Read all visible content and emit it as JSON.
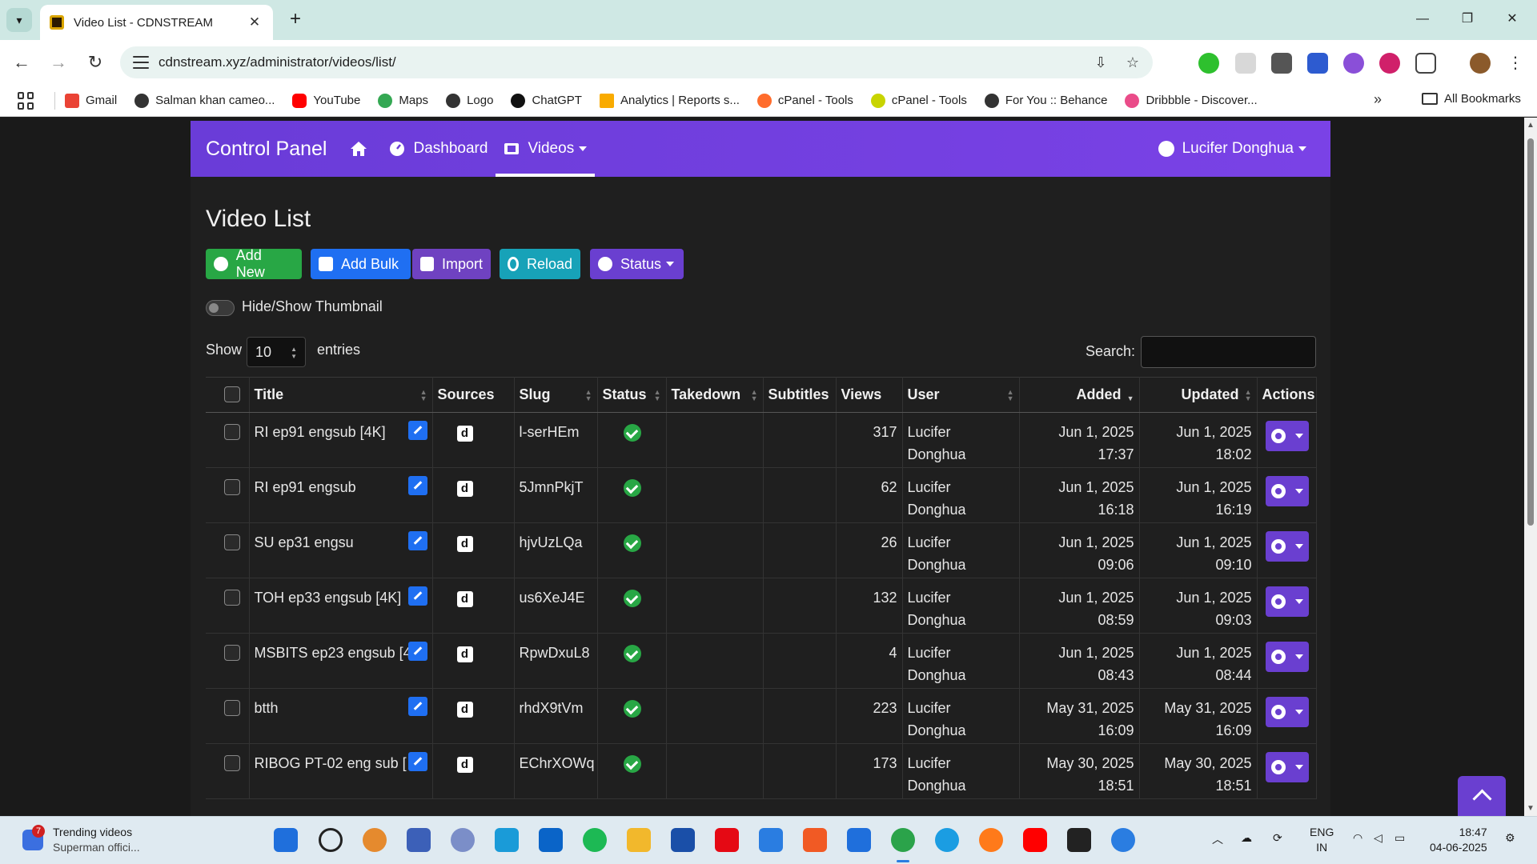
{
  "browser": {
    "tab_title": "Video List - CDNSTREAM",
    "url": "cdnstream.xyz/administrator/videos/list/",
    "bookmarks": [
      {
        "label": "Gmail",
        "color": "#ea4335"
      },
      {
        "label": "Salman khan cameo...",
        "color": "#333333"
      },
      {
        "label": "YouTube",
        "color": "#ff0000"
      },
      {
        "label": "Maps",
        "color": "#34a853"
      },
      {
        "label": "Logo",
        "color": "#333333"
      },
      {
        "label": "ChatGPT",
        "color": "#111111"
      },
      {
        "label": "Analytics | Reports s...",
        "color": "#f9ab00"
      },
      {
        "label": "cPanel - Tools",
        "color": "#ff6c2c"
      },
      {
        "label": "cPanel - Tools",
        "color": "#c8d400"
      },
      {
        "label": "For You :: Behance",
        "color": "#333333"
      },
      {
        "label": "Dribbble - Discover...",
        "color": "#ea4c89"
      }
    ],
    "all_bookmarks": "All Bookmarks"
  },
  "app": {
    "brand": "Control Panel",
    "nav": {
      "dashboard": "Dashboard",
      "videos": "Videos",
      "user": "Lucifer Donghua"
    },
    "page_title": "Video List",
    "buttons": {
      "add_new": "Add New",
      "add_bulk": "Add Bulk",
      "import": "Import",
      "reload": "Reload",
      "status": "Status"
    },
    "thumbnail_toggle": "Hide/Show Thumbnail",
    "length": {
      "show": "Show",
      "value": "10",
      "entries": "entries"
    },
    "search_label": "Search:",
    "columns": [
      "Title",
      "Sources",
      "Slug",
      "Status",
      "Takedown",
      "Subtitles",
      "Views",
      "User",
      "Added",
      "Updated",
      "Actions"
    ],
    "rows": [
      {
        "title": "RI ep91 engsub [4K]",
        "source": "d",
        "slug": "l-serHEm",
        "views": "317",
        "user1": "Lucifer",
        "user2": "Donghua",
        "added_date": "Jun 1, 2025",
        "added_time": "17:37",
        "updated_date": "Jun 1, 2025",
        "updated_time": "18:02"
      },
      {
        "title": "RI ep91 engsub",
        "source": "d",
        "slug": "5JmnPkjT",
        "views": "62",
        "user1": "Lucifer",
        "user2": "Donghua",
        "added_date": "Jun 1, 2025",
        "added_time": "16:18",
        "updated_date": "Jun 1, 2025",
        "updated_time": "16:19"
      },
      {
        "title": "SU ep31 engsu",
        "source": "d",
        "slug": "hjvUzLQa",
        "views": "26",
        "user1": "Lucifer",
        "user2": "Donghua",
        "added_date": "Jun 1, 2025",
        "added_time": "09:06",
        "updated_date": "Jun 1, 2025",
        "updated_time": "09:10"
      },
      {
        "title": "TOH ep33 engsub [4K]",
        "source": "d",
        "slug": "us6XeJ4E",
        "views": "132",
        "user1": "Lucifer",
        "user2": "Donghua",
        "added_date": "Jun 1, 2025",
        "added_time": "08:59",
        "updated_date": "Jun 1, 2025",
        "updated_time": "09:03"
      },
      {
        "title": "MSBITS ep23 engsub [4",
        "source": "d",
        "slug": "RpwDxuL8",
        "views": "4",
        "user1": "Lucifer",
        "user2": "Donghua",
        "added_date": "Jun 1, 2025",
        "added_time": "08:43",
        "updated_date": "Jun 1, 2025",
        "updated_time": "08:44"
      },
      {
        "title": "btth",
        "source": "d",
        "slug": "rhdX9tVm",
        "views": "223",
        "user1": "Lucifer",
        "user2": "Donghua",
        "added_date": "May 31, 2025",
        "added_time": "16:09",
        "updated_date": "May 31, 2025",
        "updated_time": "16:09"
      },
      {
        "title": "RIBOG PT-02 eng sub [",
        "source": "d",
        "slug": "EChrXOWq",
        "views": "173",
        "user1": "Lucifer",
        "user2": "Donghua",
        "added_date": "May 30, 2025",
        "added_time": "18:51",
        "updated_date": "May 30, 2025",
        "updated_time": "18:51"
      }
    ]
  },
  "taskbar": {
    "news_count": "7",
    "news_title": "Trending videos",
    "news_sub": "Superman offici...",
    "lang1": "ENG",
    "lang2": "IN",
    "time": "18:47",
    "date": "04-06-2025"
  }
}
